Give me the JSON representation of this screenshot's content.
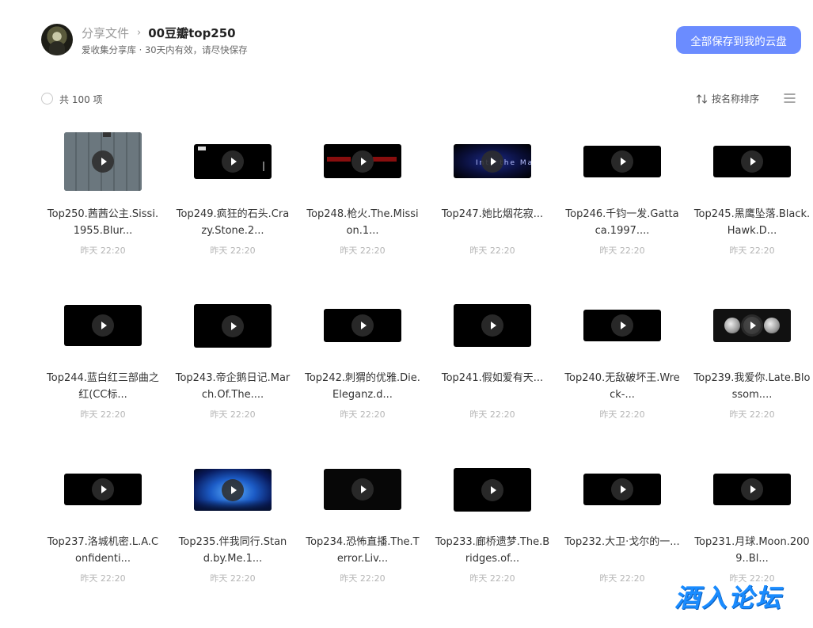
{
  "header": {
    "breadcrumb_root": "分享文件",
    "breadcrumb_sep": "›",
    "breadcrumb_current": "00豆瓣top250",
    "subtitle": "爱收集分享库 · 30天内有效，请尽快保存",
    "save_button_label": "全部保存到我的云盘"
  },
  "toolbar": {
    "count_label": "共 100 项",
    "sort_label": "按名称排序"
  },
  "files": [
    {
      "title": "Top250.茜茜公主.Sissi.1955.Blur...",
      "time": "昨天 22:20"
    },
    {
      "title": "Top249.疯狂的石头.Crazy.Stone.2...",
      "time": "昨天 22:20"
    },
    {
      "title": "Top248.枪火.The.Mission.1...",
      "time": "昨天 22:20"
    },
    {
      "title": "Top247.她比烟花寂...",
      "time": "昨天 22:20"
    },
    {
      "title": "Top246.千钧一发.Gattaca.1997....",
      "time": "昨天 22:20"
    },
    {
      "title": "Top245.黑鹰坠落.Black.Hawk.D...",
      "time": "昨天 22:20"
    },
    {
      "title": "Top244.蓝白红三部曲之红(CC标...",
      "time": "昨天 22:20"
    },
    {
      "title": "Top243.帝企鹅日记.March.Of.The....",
      "time": "昨天 22:20"
    },
    {
      "title": "Top242.刺猬的优雅.Die.Eleganz.d...",
      "time": "昨天 22:20"
    },
    {
      "title": "Top241.假如爱有天...",
      "time": "昨天 22:20"
    },
    {
      "title": "Top240.无敌破坏王.Wreck-...",
      "time": "昨天 22:20"
    },
    {
      "title": "Top239.我爱你.Late.Blossom....",
      "time": "昨天 22:20"
    },
    {
      "title": "Top237.洛城机密.L.A.Confidenti...",
      "time": "昨天 22:20"
    },
    {
      "title": "Top235.伴我同行.Stand.by.Me.1...",
      "time": "昨天 22:20"
    },
    {
      "title": "Top234.恐怖直播.The.Terror.Liv...",
      "time": "昨天 22:20"
    },
    {
      "title": "Top233.廊桥遗梦.The.Bridges.of...",
      "time": "昨天 22:20"
    },
    {
      "title": "Top232.大卫·戈尔的一...",
      "time": "昨天 22:20"
    },
    {
      "title": "Top231.月球.Moon.2009..Bl...",
      "time": "昨天 22:20"
    }
  ],
  "thumb_text": {
    "top247": "Into the Mafia"
  },
  "colors": {
    "accent": "#6b8cff",
    "watermark": "#1a8cff"
  },
  "watermark": "酒入论坛"
}
